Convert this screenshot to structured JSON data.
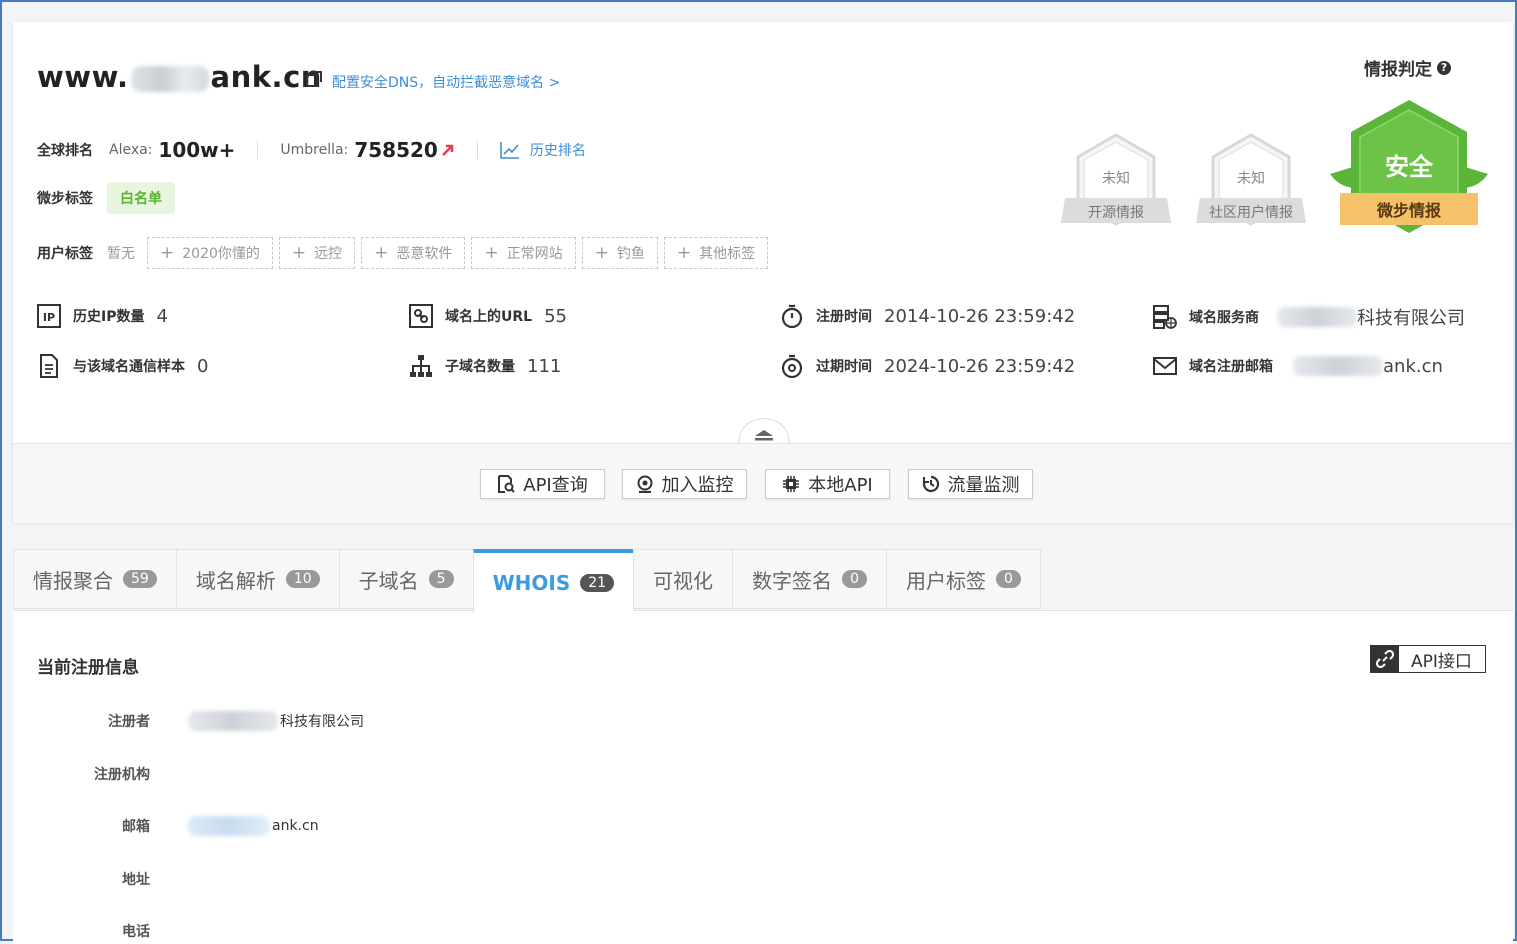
{
  "header": {
    "domain_prefix": "www.",
    "domain_suffix": "ank.cn",
    "dns_link": "配置安全DNS，自动拦截恶意域名 >"
  },
  "ranking": {
    "label": "全球排名",
    "alexa_label": "Alexa:",
    "alexa_value": "100w+",
    "umbrella_label": "Umbrella:",
    "umbrella_value": "758520",
    "history_link": "历史排名"
  },
  "weibu_tags": {
    "label": "微步标签",
    "tag": "白名单"
  },
  "user_tags": {
    "label": "用户标签",
    "none": "暂无",
    "items": [
      "2020你懂的",
      "远控",
      "恶意软件",
      "正常网站",
      "钓鱼",
      "其他标签"
    ]
  },
  "stats": {
    "history_ip_label": "历史IP数量",
    "history_ip_value": "4",
    "url_label": "域名上的URL",
    "url_value": "55",
    "reg_time_label": "注册时间",
    "reg_time_value": "2014-10-26 23:59:42",
    "registrar_label": "域名服务商",
    "registrar_value_tail": "科技有限公司",
    "samples_label": "与该域名通信样本",
    "samples_value": "0",
    "subdomain_label": "子域名数量",
    "subdomain_value": "111",
    "expire_time_label": "过期时间",
    "expire_time_value": "2024-10-26 23:59:42",
    "email_label": "域名注册邮箱",
    "email_value_tail": "ank.cn"
  },
  "actions": {
    "api_query": "API查询",
    "add_monitor": "加入监控",
    "local_api": "本地API",
    "traffic_monitor": "流量监测"
  },
  "verdict": {
    "title": "情报判定",
    "open_source_status": "未知",
    "open_source_label": "开源情报",
    "community_status": "未知",
    "community_label": "社区用户情报",
    "weibu_status": "安全",
    "weibu_label": "微步情报"
  },
  "tabs": [
    {
      "label": "情报聚合",
      "count": "59"
    },
    {
      "label": "域名解析",
      "count": "10"
    },
    {
      "label": "子域名",
      "count": "5"
    },
    {
      "label": "WHOIS",
      "count": "21"
    },
    {
      "label": "可视化",
      "count": ""
    },
    {
      "label": "数字签名",
      "count": "0"
    },
    {
      "label": "用户标签",
      "count": "0"
    }
  ],
  "whois": {
    "title": "当前注册信息",
    "api_button": "API接口",
    "rows": [
      {
        "label": "注册者",
        "value": "科技有限公司"
      },
      {
        "label": "注册机构",
        "value": ""
      },
      {
        "label": "邮箱",
        "value": "ank.cn"
      },
      {
        "label": "地址",
        "value": ""
      },
      {
        "label": "电话",
        "value": ""
      }
    ]
  },
  "colors": {
    "accent_blue": "#3e9be0",
    "safe_green": "#5bb53b",
    "safe_orange": "#f5c169",
    "trend_red": "#e04050"
  }
}
